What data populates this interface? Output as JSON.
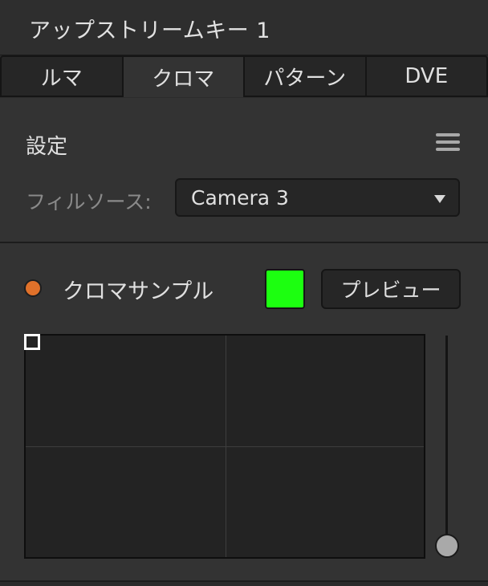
{
  "header": {
    "title": "アップストリームキー 1"
  },
  "tabs": [
    {
      "label": "ルマ",
      "active": false
    },
    {
      "label": "クロマ",
      "active": true
    },
    {
      "label": "パターン",
      "active": false
    },
    {
      "label": "DVE",
      "active": false
    }
  ],
  "settings": {
    "label": "設定",
    "menu_icon": "hamburger-menu-icon",
    "fill_source_label": "フィルソース:",
    "fill_source_value": "Camera 3"
  },
  "chroma_sample": {
    "label": "クロマサンプル",
    "indicator_color": "#e0712a",
    "swatch_color": "#1cff10",
    "preview_label": "プレビュー",
    "slider_value_fraction": 0.0
  },
  "colors": {
    "panel_bg": "#333333",
    "header_bg": "#2e2e2e",
    "accent_orange": "#e0712a"
  }
}
